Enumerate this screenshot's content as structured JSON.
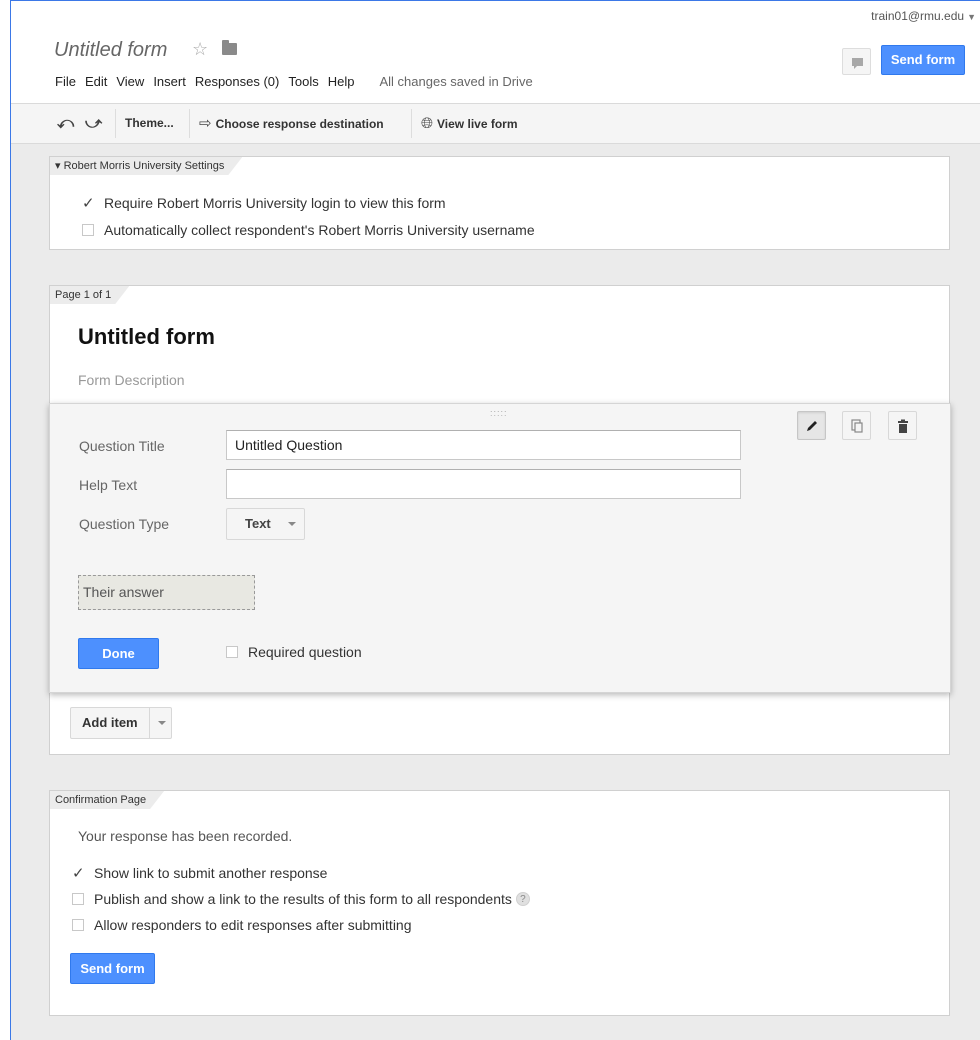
{
  "header": {
    "doc_title": "Untitled form",
    "star_icon": "star-icon",
    "folder_icon": "folder-icon",
    "user_email": "train01@rmu.edu",
    "send_label": "Send form",
    "menus": [
      "File",
      "Edit",
      "View",
      "Insert",
      "Responses (0)",
      "Tools",
      "Help"
    ],
    "save_status": "All changes saved in Drive"
  },
  "toolbar": {
    "theme_label": "Theme...",
    "destination_label": "Choose response destination",
    "live_label": "View live form"
  },
  "settings": {
    "tab": "Robert Morris University Settings",
    "options": [
      {
        "label": "Require Robert Morris University login to view this form",
        "checked": true
      },
      {
        "label": "Automatically collect respondent's Robert Morris University username",
        "checked": false
      }
    ]
  },
  "page": {
    "tab": "Page 1 of 1",
    "title": "Untitled form",
    "description_placeholder": "Form Description",
    "add_item_label": "Add item"
  },
  "question": {
    "title_label": "Question Title",
    "title_value": "Untitled Question",
    "help_label": "Help Text",
    "help_value": "",
    "type_label": "Question Type",
    "type_value": "Text",
    "answer_preview": "Their answer",
    "done_label": "Done",
    "required_label": "Required question",
    "required_checked": false
  },
  "confirmation": {
    "tab": "Confirmation Page",
    "message": "Your response has been recorded.",
    "options": [
      {
        "label": "Show link to submit another response",
        "checked": true
      },
      {
        "label": "Publish and show a link to the results of this form to all respondents",
        "checked": false,
        "help": "?"
      },
      {
        "label": "Allow responders to edit responses after submitting",
        "checked": false
      }
    ],
    "send_label": "Send form"
  },
  "colors": {
    "accent_blue": "#4d90fe",
    "frame_border": "#3b78e7",
    "canvas_bg": "#ebebeb"
  }
}
